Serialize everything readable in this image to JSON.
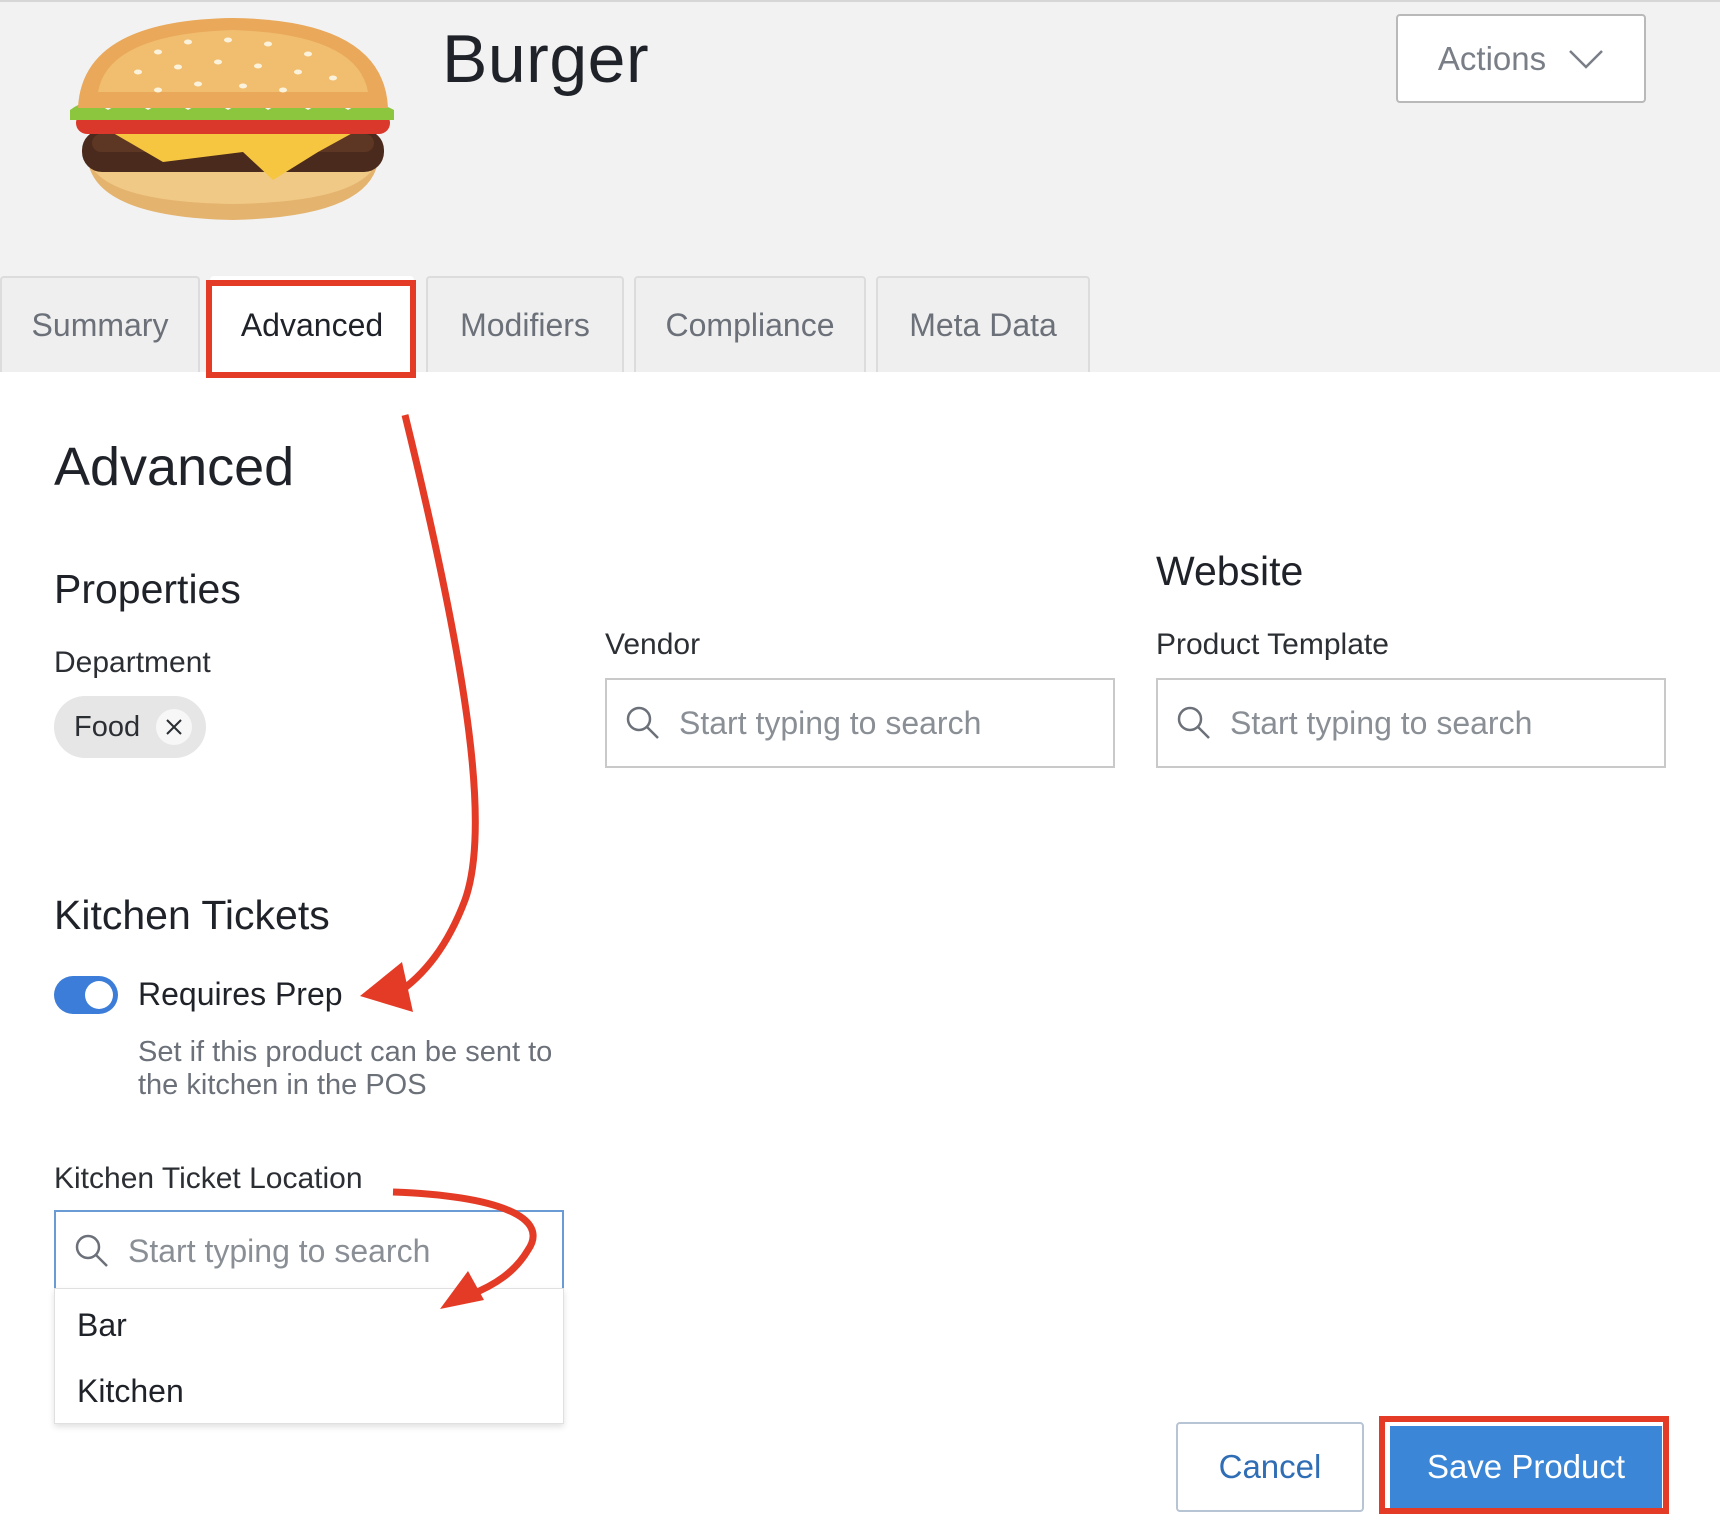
{
  "product": {
    "title": "Burger",
    "image_alt": "burger image"
  },
  "header": {
    "actions_label": "Actions"
  },
  "tabs": [
    {
      "label": "Summary",
      "active": false
    },
    {
      "label": "Advanced",
      "active": true
    },
    {
      "label": "Modifiers",
      "active": false
    },
    {
      "label": "Compliance",
      "active": false
    },
    {
      "label": "Meta Data",
      "active": false
    }
  ],
  "advanced": {
    "heading": "Advanced",
    "properties": {
      "heading": "Properties",
      "department_label": "Department",
      "department_chip": "Food"
    },
    "vendor": {
      "label": "Vendor",
      "placeholder": "Start typing to search"
    },
    "website": {
      "heading": "Website",
      "product_template_label": "Product Template",
      "placeholder": "Start typing to search"
    },
    "kitchen_tickets": {
      "heading": "Kitchen Tickets",
      "requires_prep_label": "Requires Prep",
      "requires_prep_on": true,
      "help_text": "Set if this product can be sent to the kitchen in the POS",
      "location_label": "Kitchen Ticket Location",
      "location_placeholder": "Start typing to search",
      "location_options": [
        "Bar",
        "Kitchen"
      ]
    }
  },
  "footer": {
    "cancel_label": "Cancel",
    "save_label": "Save Product"
  },
  "colors": {
    "primary": "#3b86d6",
    "toggle_on": "#3b7dd8",
    "annotation_red": "#e43b26",
    "header_bg": "#f2f2f2"
  }
}
